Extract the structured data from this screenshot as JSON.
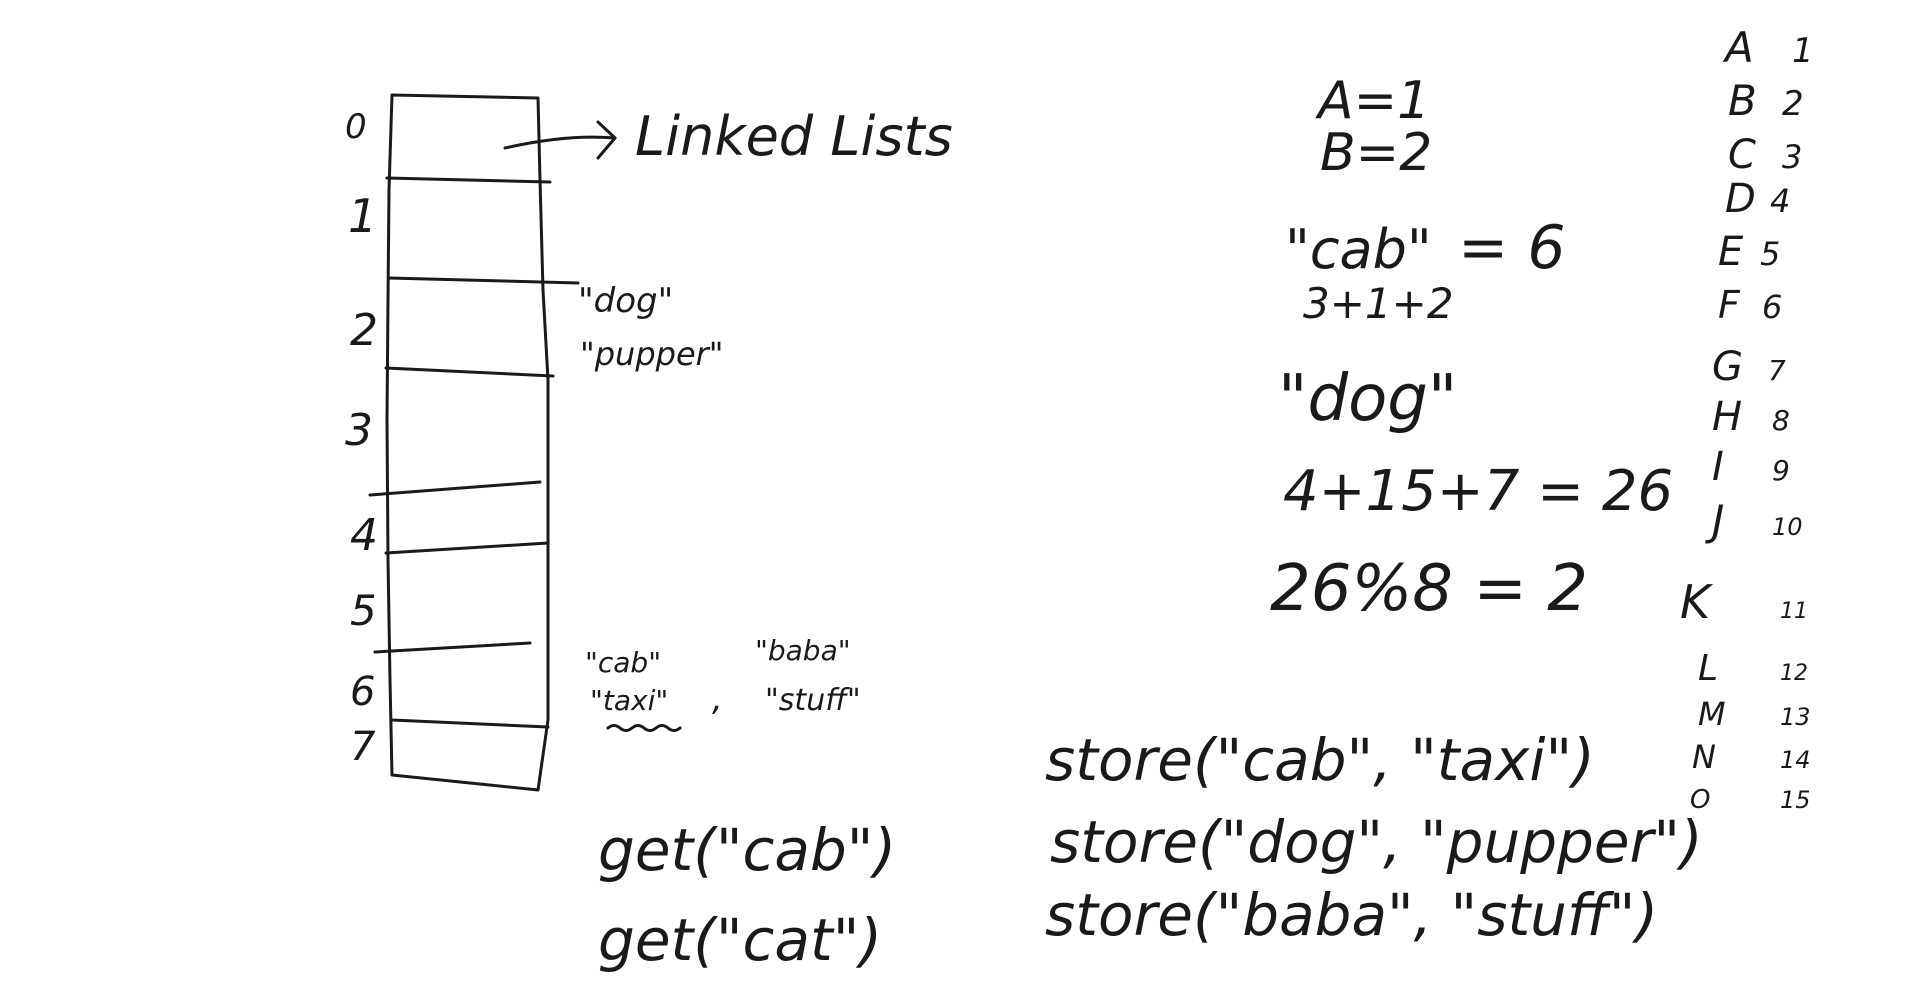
{
  "hash_table": {
    "indices": [
      "0",
      "1",
      "2",
      "3",
      "4",
      "5",
      "6",
      "7"
    ],
    "arrow_label": "Linked Lists",
    "bucket_2": [
      "\"dog\"",
      "\"pupper\""
    ],
    "bucket_6_left": [
      "\"cab\"",
      "\"taxi\""
    ],
    "bucket_6_sep": ",",
    "bucket_6_right": [
      "\"baba\"",
      "\"stuff\""
    ]
  },
  "get_calls": [
    "get(\"cab\")",
    "get(\"cat\")"
  ],
  "store_calls": [
    "store(\"cab\", \"taxi\")",
    "store(\"dog\", \"pupper\")",
    "store(\"baba\", \"stuff\")"
  ],
  "math": {
    "a_eq": "A=1",
    "b_eq": "B=2",
    "cab_word": "\"cab\"",
    "cab_sum": "3+1+2",
    "cab_result": "= 6",
    "dog_word": "\"dog\"",
    "dog_sum": "4+15+7 = 26",
    "modulo": "26%8 = 2"
  },
  "alphabet": [
    {
      "letter": "A",
      "value": "1"
    },
    {
      "letter": "B",
      "value": "2"
    },
    {
      "letter": "C",
      "value": "3"
    },
    {
      "letter": "D",
      "value": "4"
    },
    {
      "letter": "E",
      "value": "5"
    },
    {
      "letter": "F",
      "value": "6"
    },
    {
      "letter": "G",
      "value": "7"
    },
    {
      "letter": "H",
      "value": "8"
    },
    {
      "letter": "I",
      "value": "9"
    },
    {
      "letter": "J",
      "value": "10"
    },
    {
      "letter": "K",
      "value": "11"
    },
    {
      "letter": "L",
      "value": "12"
    },
    {
      "letter": "M",
      "value": "13"
    },
    {
      "letter": "N",
      "value": "14"
    },
    {
      "letter": "O",
      "value": "15"
    }
  ]
}
